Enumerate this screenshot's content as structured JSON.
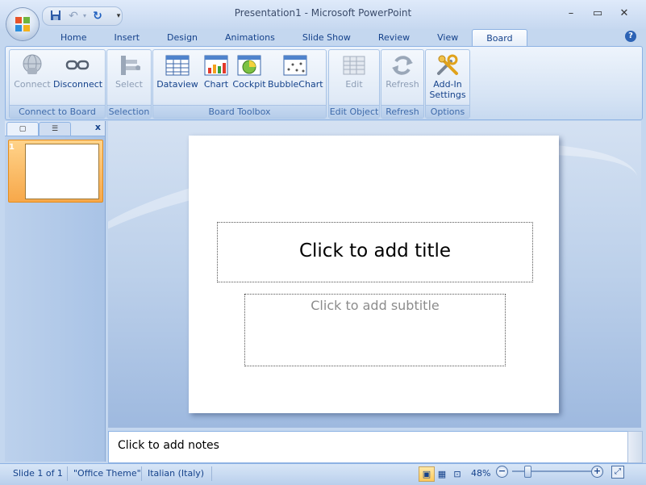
{
  "window": {
    "title": "Presentation1 - Microsoft PowerPoint",
    "minimize_icon": "minimize-icon",
    "maximize_icon": "maximize-icon",
    "close_icon": "close-icon"
  },
  "quick_access": {
    "save_icon": "save-icon",
    "undo_icon": "undo-icon",
    "redo_icon": "redo-icon",
    "customize_icon": "chevron-down-icon"
  },
  "tabs": [
    "Home",
    "Insert",
    "Design",
    "Animations",
    "Slide Show",
    "Review",
    "View",
    "Board"
  ],
  "active_tab": "Board",
  "ribbon": {
    "groups": [
      {
        "label": "Connect to Board",
        "buttons": [
          {
            "label": "Connect",
            "enabled": false
          },
          {
            "label": "Disconnect",
            "enabled": true
          }
        ]
      },
      {
        "label": "Selection",
        "buttons": [
          {
            "label": "Select",
            "enabled": false
          }
        ]
      },
      {
        "label": "Board Toolbox",
        "buttons": [
          {
            "label": "Dataview",
            "enabled": true
          },
          {
            "label": "Chart",
            "enabled": true
          },
          {
            "label": "Cockpit",
            "enabled": true
          },
          {
            "label": "BubbleChart",
            "enabled": true
          }
        ]
      },
      {
        "label": "Edit Object",
        "buttons": [
          {
            "label": "Edit",
            "enabled": false
          }
        ]
      },
      {
        "label": "Refresh",
        "buttons": [
          {
            "label": "Refresh",
            "enabled": false
          }
        ]
      },
      {
        "label": "Options",
        "buttons": [
          {
            "label": "Add-In\nSettings",
            "line1": "Add-In",
            "line2": "Settings",
            "enabled": true
          }
        ]
      }
    ]
  },
  "slides_panel": {
    "close_label": "x",
    "thumbnail_number": "1"
  },
  "slide": {
    "title_placeholder": "Click to add title",
    "subtitle_placeholder": "Click to add subtitle"
  },
  "notes": {
    "placeholder": "Click to add notes"
  },
  "status": {
    "slide_counter": "Slide 1 of 1",
    "theme": "\"Office Theme\"",
    "language": "Italian (Italy)",
    "zoom": "48%",
    "zoom_minus": "−",
    "zoom_plus": "+"
  },
  "colors": {
    "ribbon_text": "#15428b",
    "active_thumbnail": "#f7a84a",
    "stage_background": "#bcd0ea"
  }
}
